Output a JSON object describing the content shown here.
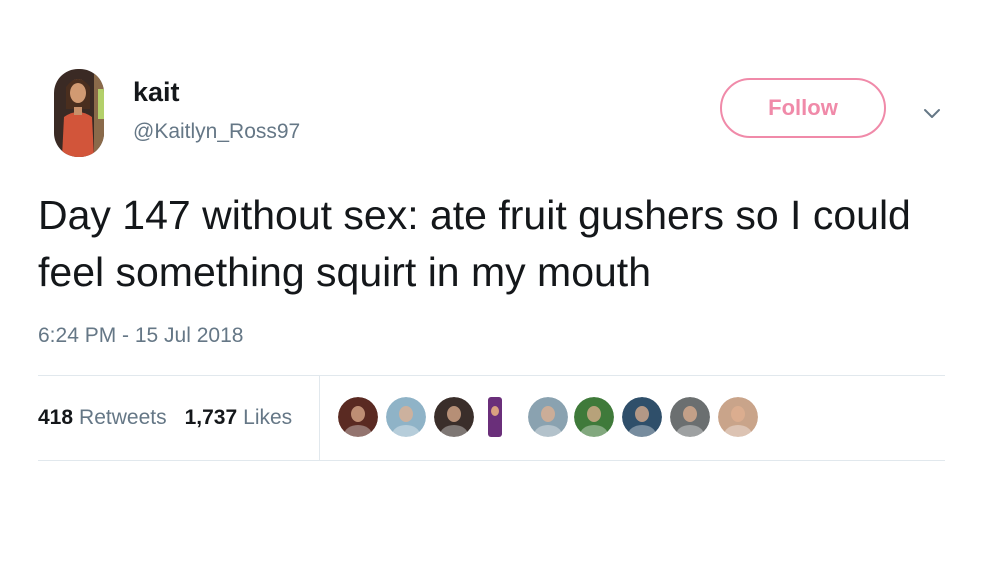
{
  "user": {
    "display_name": "kait",
    "handle": "@Kaitlyn_Ross97",
    "avatar_icon": "profile-photo"
  },
  "follow_button": {
    "label": "Follow"
  },
  "menu": {
    "icon": "chevron-down-icon"
  },
  "tweet": {
    "text": "Day 147 without sex: ate fruit gushers so I could feel something squirt in my mouth",
    "timestamp": "6:24 PM - 15 Jul 2018"
  },
  "stats": {
    "retweets_count": "418",
    "retweets_label": "Retweets",
    "likes_count": "1,737",
    "likes_label": "Likes"
  },
  "liker_avatars": [
    {
      "icon": "liker-avatar",
      "color": "#5a2a22"
    },
    {
      "icon": "liker-avatar",
      "color": "#8fb3c7"
    },
    {
      "icon": "liker-avatar",
      "color": "#3a2e2a"
    },
    {
      "icon": "liker-avatar",
      "color": "#6a2f7a"
    },
    {
      "icon": "liker-avatar",
      "color": "#8aa2b0"
    },
    {
      "icon": "liker-avatar",
      "color": "#3f7a3a"
    },
    {
      "icon": "liker-avatar",
      "color": "#2f4f6a"
    },
    {
      "icon": "liker-avatar",
      "color": "#6b6f70"
    },
    {
      "icon": "liker-avatar",
      "color": "#c9a48a"
    }
  ],
  "colors": {
    "follow_accent": "#f08aa9",
    "secondary_text": "#657786",
    "primary_text": "#14171a",
    "divider": "#e1e8ed"
  }
}
